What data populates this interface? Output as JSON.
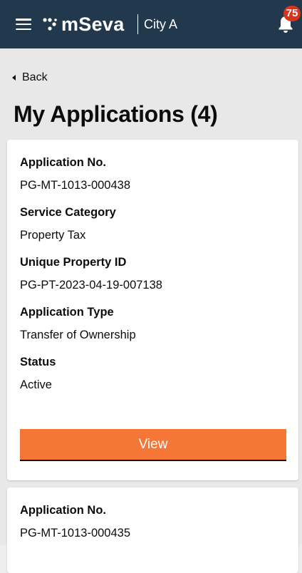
{
  "header": {
    "brand": "mSeva",
    "city": "City A",
    "notification_count": "75"
  },
  "page": {
    "back_label": "Back",
    "title": "My Applications (4)"
  },
  "applications": [
    {
      "application_no_label": "Application No.",
      "application_no": "PG-MT-1013-000438",
      "service_category_label": "Service Category",
      "service_category": "Property Tax",
      "property_id_label": "Unique Property ID",
      "property_id": "PG-PT-2023-04-19-007138",
      "application_type_label": "Application Type",
      "application_type": "Transfer of Ownership",
      "status_label": "Status",
      "status": "Active",
      "view_label": "View"
    },
    {
      "application_no_label": "Application No.",
      "application_no": "PG-MT-1013-000435"
    }
  ],
  "colors": {
    "header_bg": "#22394d",
    "accent": "#f47738",
    "badge": "#d4351c"
  },
  "icons": {
    "menu": "hamburger-menu-icon",
    "logo": "mseva-logo-icon",
    "notifications": "bell-icon",
    "back": "chevron-left-icon"
  }
}
